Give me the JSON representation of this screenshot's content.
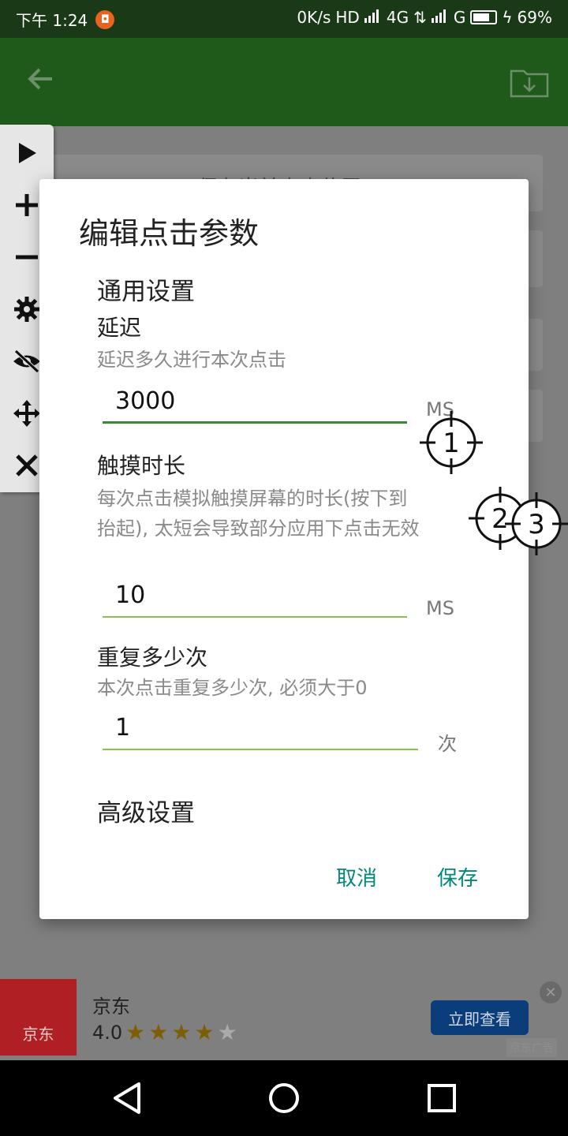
{
  "status_bar": {
    "time": "下午 1:24",
    "network_speed": "0K/s",
    "hd": "HD",
    "network_1": "4G",
    "network_2": "G",
    "battery": "69%"
  },
  "background": {
    "button_partial_title": "保存当前点击位置"
  },
  "markers": [
    "1",
    "2",
    "3"
  ],
  "dialog": {
    "title": "编辑点击参数",
    "general_section": "通用设置",
    "delay": {
      "label": "延迟",
      "description": "延迟多久进行本次点击",
      "value": "3000",
      "unit": "MS"
    },
    "touch_duration": {
      "label": "触摸时长",
      "description": "每次点击模拟触摸屏幕的时长(按下到抬起), 太短会导致部分应用下点击无效",
      "value": "10",
      "unit": "MS"
    },
    "repeat": {
      "label": "重复多少次",
      "description": "本次点击重复多少次, 必须大于0",
      "value": "1",
      "unit": "次"
    },
    "advanced_section": "高级设置",
    "cancel_label": "取消",
    "save_label": "保存",
    "accent_color": "#00897b"
  },
  "ad": {
    "logo_text": "京东",
    "name": "京东",
    "rating": "4.0",
    "stars": 4,
    "cta_label": "立即查看",
    "tag": "京东广告"
  }
}
